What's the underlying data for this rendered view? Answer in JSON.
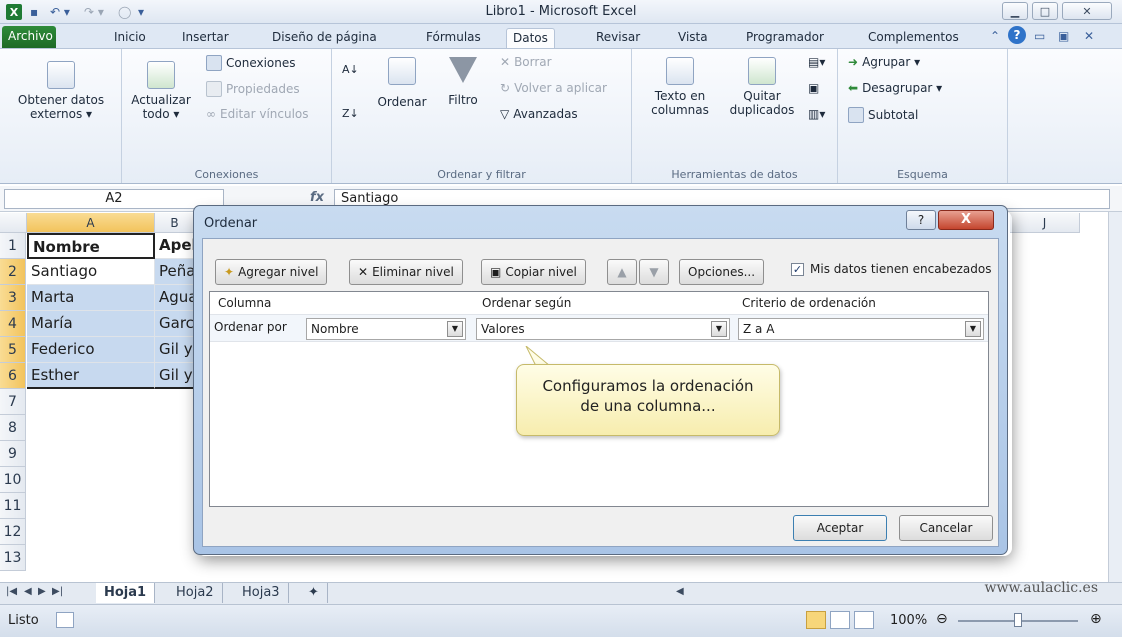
{
  "window": {
    "title": "Libro1 - Microsoft Excel",
    "minimize_icon": "minimize-icon",
    "maximize_icon": "maximize-icon",
    "close_icon": "close-icon"
  },
  "ribbon_tabs": [
    "Archivo",
    "Inicio",
    "Insertar",
    "Diseño de página",
    "Fórmulas",
    "Datos",
    "Revisar",
    "Vista",
    "Programador",
    "Complementos"
  ],
  "active_tab": "Datos",
  "ribbon": {
    "externos": {
      "label1": "Obtener datos",
      "label2": "externos ▾"
    },
    "actualizar": {
      "label1": "Actualizar",
      "label2": "todo ▾"
    },
    "conexiones": {
      "conexiones": "Conexiones",
      "propiedades": "Propiedades",
      "editar": "Editar vínculos",
      "group": "Conexiones"
    },
    "ordenar": {
      "ordenar": "Ordenar",
      "filtro": "Filtro",
      "borrar": "Borrar",
      "volver": "Volver a aplicar",
      "avanzadas": "Avanzadas",
      "group": "Ordenar y filtrar"
    },
    "herramientas": {
      "texto1": "Texto en",
      "texto2": "columnas",
      "quitar1": "Quitar",
      "quitar2": "duplicados",
      "group": "Herramientas de datos"
    },
    "esquema": {
      "agrupar": "Agrupar ▾",
      "desagrupar": "Desagrupar ▾",
      "subtotal": "Subtotal",
      "group": "Esquema"
    }
  },
  "formula_bar": {
    "name_box": "A2",
    "fx": "fx",
    "value": "Santiago"
  },
  "grid": {
    "columns": [
      "A",
      "B",
      "J"
    ],
    "rows": [
      "1",
      "2",
      "3",
      "4",
      "5",
      "6",
      "7",
      "8",
      "9",
      "10",
      "11",
      "12",
      "13"
    ],
    "col_a": [
      "Nombre",
      "Santiago",
      "Marta",
      "María",
      "Federico",
      "Esther"
    ],
    "col_b": [
      "Apel",
      "Peña",
      "Agua",
      "Garc",
      "Gil y",
      "Gil y"
    ]
  },
  "sheets": [
    "Hoja1",
    "Hoja2",
    "Hoja3"
  ],
  "status": {
    "text": "Listo",
    "zoom": "100%"
  },
  "watermark": "www.aulaclic.es",
  "dialog": {
    "title": "Ordenar",
    "help": "?",
    "close": "X",
    "toolbar": {
      "add": "Agregar nivel",
      "delete": "Eliminar nivel",
      "copy": "Copiar nivel",
      "options": "Opciones..."
    },
    "headers_checkbox": {
      "label": "Mis datos tienen encabezados",
      "checked": true
    },
    "list_headers": {
      "column": "Columna",
      "sort_on": "Ordenar según",
      "order": "Criterio de ordenación"
    },
    "row": {
      "label": "Ordenar por",
      "column": "Nombre",
      "sort_on": "Valores",
      "order": "Z a A"
    },
    "ok": "Aceptar",
    "cancel": "Cancelar"
  },
  "callout": {
    "line1": "Configuramos la ordenación",
    "line2": "de una columna..."
  },
  "colors": {
    "accent": "#1d6a26",
    "selection": "#c7d9ef",
    "header_selected": "#f2c35c",
    "ribbon_bg": "#e6edf6"
  }
}
